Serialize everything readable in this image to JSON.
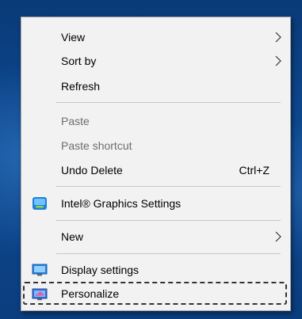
{
  "context_menu": {
    "items": [
      {
        "label": "View",
        "submenu": true
      },
      {
        "label": "Sort by",
        "submenu": true
      },
      {
        "label": "Refresh"
      },
      {
        "label": "Paste",
        "disabled": true
      },
      {
        "label": "Paste shortcut",
        "disabled": true
      },
      {
        "label": "Undo Delete",
        "shortcut": "Ctrl+Z"
      },
      {
        "label": "Intel® Graphics Settings",
        "icon": "intel-graphics-icon"
      },
      {
        "label": "New",
        "submenu": true
      },
      {
        "label": "Display settings",
        "icon": "display-icon"
      },
      {
        "label": "Personalize",
        "icon": "personalize-icon",
        "focused": true
      }
    ]
  },
  "colors": {
    "menu_background": "#f2f2f2",
    "desktop_background": "#0d4a92",
    "disabled_text": "#6d6d6d"
  }
}
